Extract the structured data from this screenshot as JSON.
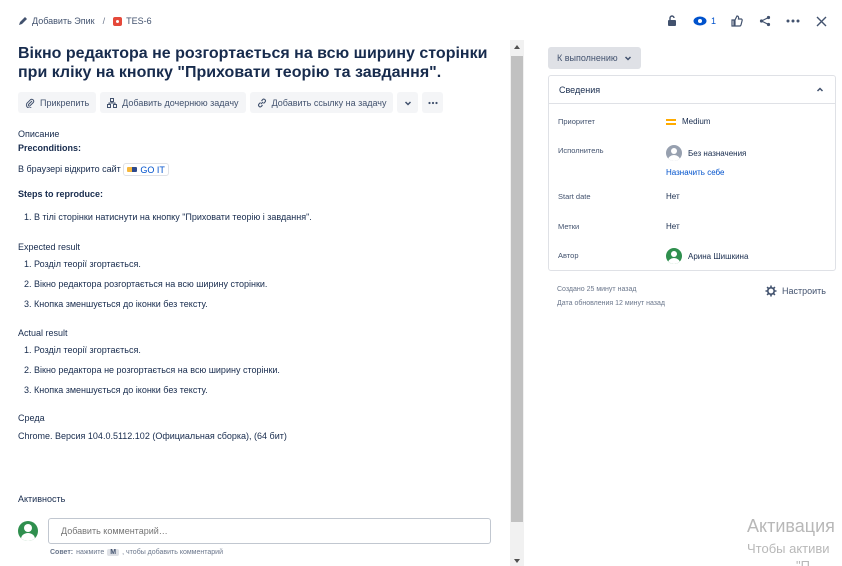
{
  "breadcrumb": {
    "add_epic": "Добавить Эпик",
    "separator": "/",
    "issue_key": "TES-6"
  },
  "header": {
    "watch_count": "1"
  },
  "issue": {
    "title": "Вікно редактора не розгортається на всю ширину сторінки при кліку на кнопку \"Приховати теорію та завдання\"."
  },
  "actions": {
    "attach": "Прикрепить",
    "add_child": "Добавить дочернюю задачу",
    "add_link": "Добавить ссылку на задачу"
  },
  "description": {
    "label": "Описание",
    "preconditions_label": "Preconditions:",
    "preconditions_text": "В браузері відкрито сайт",
    "site_tag": "GO IT",
    "steps_label": "Steps to reproduce:",
    "steps": [
      "1. В тілі сторінки натиснути на кнопку \"Приховати теорію і завдання\"."
    ],
    "expected_label": "Expected result",
    "expected": [
      "1. Розділ теорії згортається.",
      "2. Вікно редактора розгортається на всю ширину сторінки.",
      "3. Кнопка зменшується до іконки без тексту."
    ],
    "actual_label": "Actual result",
    "actual": [
      "1. Розділ теорії згортається.",
      "2. Вікно редактора не розгортається на всю ширину сторінки.",
      "3. Кнопка зменшується до іконки без тексту."
    ],
    "env_label": "Среда",
    "env_text": "Chrome. Версия 104.0.5112.102 (Официальная сборка), (64 бит)"
  },
  "activity": {
    "label": "Активность",
    "comment_placeholder": "Добавить комментарий…",
    "tip_prefix": "Совет:",
    "tip_press": "нажмите",
    "tip_key": "M",
    "tip_suffix": ", чтобы добавить комментарий"
  },
  "status": {
    "label": "К выполнению"
  },
  "details": {
    "title": "Сведения",
    "priority_label": "Приоритет",
    "priority_value": "Medium",
    "assignee_label": "Исполнитель",
    "assignee_value": "Без назначения",
    "assign_self": "Назначить себе",
    "start_label": "Start date",
    "start_value": "Нет",
    "labels_label": "Метки",
    "labels_value": "Нет",
    "author_label": "Автор",
    "author_value": "Арина Шишкина"
  },
  "meta": {
    "created": "Создано 25 минут назад",
    "updated": "Дата обновления 12 минут назад",
    "configure": "Настроить"
  },
  "watermark": {
    "line1": "Активация",
    "line2": "Чтобы активи",
    "line3": "\"П"
  },
  "colors": {
    "accent": "#0052cc",
    "priority": "#ffab00",
    "bug": "#e5493a",
    "avatar": "#2f8f4e"
  }
}
